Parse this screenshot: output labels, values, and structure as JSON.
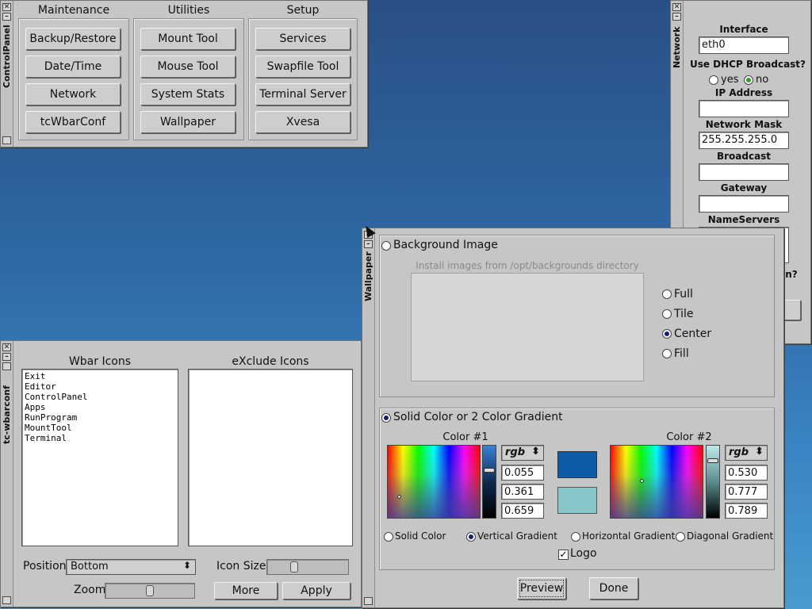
{
  "control_panel": {
    "title": "ControlPanel",
    "groups": [
      {
        "label": "Maintenance",
        "buttons": [
          "Backup/Restore",
          "Date/Time",
          "Network",
          "tcWbarConf"
        ]
      },
      {
        "label": "Utilities",
        "buttons": [
          "Mount Tool",
          "Mouse Tool",
          "System Stats",
          "Wallpaper"
        ]
      },
      {
        "label": "Setup",
        "buttons": [
          "Services",
          "Swapfile Tool",
          "Terminal Server",
          "Xvesa"
        ]
      }
    ]
  },
  "network": {
    "title": "Network",
    "interface_label": "Interface",
    "interface_value": "eth0",
    "dhcp_label": "Use DHCP Broadcast?",
    "dhcp_yes": "yes",
    "dhcp_no": "no",
    "dhcp_selected": "no",
    "ip_label": "IP Address",
    "ip_value": "",
    "mask_label": "Network Mask",
    "mask_value": "255.255.255.0",
    "broadcast_label": "Broadcast",
    "broadcast_value": "",
    "gateway_label": "Gateway",
    "gateway_value": "",
    "nameservers_label": "NameServers",
    "partial_text": "n?"
  },
  "wbar": {
    "title": "tc-wbarconf",
    "wbar_icons_label": "Wbar Icons",
    "exclude_icons_label": "eXclude Icons",
    "wbar_icons": [
      "Exit",
      "Editor",
      "ControlPanel",
      "Apps",
      "RunProgram",
      "MountTool",
      "Terminal"
    ],
    "exclude_icons": [],
    "position_label": "Position",
    "position_value": "Bottom",
    "icon_size_label": "Icon Size",
    "zoom_label": "Zoom",
    "more_label": "More",
    "apply_label": "Apply"
  },
  "wallpaper": {
    "title": "Wallpaper",
    "bg_image_label": "Background Image",
    "install_hint": "Install images from /opt/backgrounds directory",
    "modes": [
      "Full",
      "Tile",
      "Center",
      "Fill"
    ],
    "mode_selected": "Center",
    "solid_label": "Solid Color or 2 Color Gradient",
    "color1_label": "Color #1",
    "color2_label": "Color #2",
    "color1_mode": "rgb",
    "color2_mode": "rgb",
    "color1_values": [
      "0.055",
      "0.361",
      "0.659"
    ],
    "color2_values": [
      "0.530",
      "0.777",
      "0.789"
    ],
    "color1_hex": "#0e5ca8",
    "color2_hex": "#87c6c9",
    "gradient_types": [
      "Solid Color",
      "Vertical Gradient",
      "Horizontal Gradient",
      "Diagonal Gradient"
    ],
    "gradient_selected": "Vertical Gradient",
    "logo_label": "Logo",
    "logo_checked": true,
    "preview_label": "Preview",
    "done_label": "Done"
  }
}
